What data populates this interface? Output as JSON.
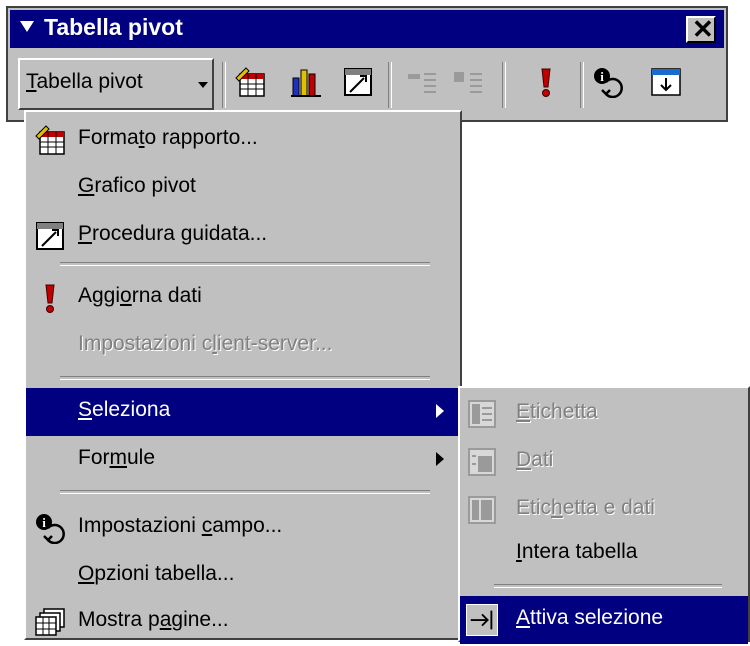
{
  "toolbar": {
    "title": "Tabella pivot",
    "close_glyph": "✕",
    "dropdown": {
      "pre": "",
      "mnemonic": "T",
      "post": "abella pivot"
    },
    "icons": [
      "format-report-icon",
      "pivot-chart-icon",
      "wizard-icon",
      "hide-detail-icon",
      "show-detail-icon",
      "refresh-data-icon",
      "field-settings-icon",
      "show-pages-icon"
    ]
  },
  "menu": {
    "items": [
      {
        "pre": "Forma",
        "mnemonic": "t",
        "post": "o rapporto...",
        "icon": "format-report-icon",
        "disabled": false
      },
      {
        "pre": "",
        "mnemonic": "G",
        "post": "rafico pivot",
        "icon": "",
        "disabled": false
      },
      {
        "pre": "",
        "mnemonic": "P",
        "post": "rocedura guidata...",
        "icon": "wizard-icon",
        "disabled": false
      },
      {
        "pre": "Aggi",
        "mnemonic": "o",
        "post": "rna dati",
        "icon": "refresh-data-icon",
        "disabled": false
      },
      {
        "pre": "Impostazioni c",
        "mnemonic": "l",
        "post": "ient-server...",
        "icon": "",
        "disabled": true
      },
      {
        "pre": "",
        "mnemonic": "S",
        "post": "eleziona",
        "icon": "",
        "disabled": false,
        "submenu": true,
        "highlighted": true
      },
      {
        "pre": "For",
        "mnemonic": "m",
        "post": "ule",
        "icon": "",
        "disabled": false,
        "submenu": true
      },
      {
        "pre": "Impostazioni ",
        "mnemonic": "c",
        "post": "ampo...",
        "icon": "field-settings-icon",
        "disabled": false
      },
      {
        "pre": "",
        "mnemonic": "O",
        "post": "pzioni tabella...",
        "icon": "",
        "disabled": false
      },
      {
        "pre": "Mostra p",
        "mnemonic": "a",
        "post": "gine...",
        "icon": "show-pages-icon",
        "disabled": false
      }
    ]
  },
  "submenu": {
    "items": [
      {
        "pre": "",
        "mnemonic": "E",
        "post": "tichetta",
        "icon": "select-label-icon",
        "disabled": true
      },
      {
        "pre": "",
        "mnemonic": "D",
        "post": "ati",
        "icon": "select-data-icon",
        "disabled": true
      },
      {
        "pre": "Etic",
        "mnemonic": "h",
        "post": "etta e dati",
        "icon": "select-label-data-icon",
        "disabled": true
      },
      {
        "pre": "",
        "mnemonic": "I",
        "post": "ntera tabella",
        "icon": "",
        "disabled": false
      },
      {
        "pre": "",
        "mnemonic": "A",
        "post": "ttiva selezione",
        "icon": "enable-selection-icon",
        "disabled": false,
        "highlighted": true
      }
    ]
  },
  "colors": {
    "menu_bg": "#c0c0c0",
    "highlight": "#000080",
    "title_bar": "#000080",
    "disabled_text": "#808080"
  }
}
